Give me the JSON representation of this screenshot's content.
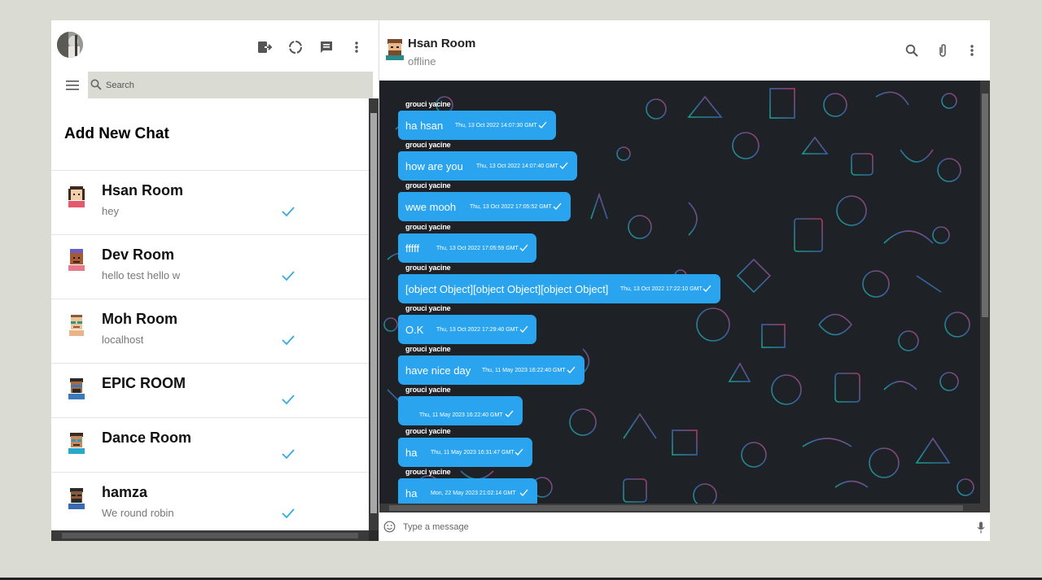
{
  "sidebar": {
    "search_placeholder": "Search",
    "add_chat_label": "Add New Chat",
    "chats": [
      {
        "name": "Hsan Room",
        "last_message": "hey",
        "avatar": "avatar-1"
      },
      {
        "name": "Dev Room",
        "last_message": "hello test hello w",
        "avatar": "avatar-2"
      },
      {
        "name": "Moh Room",
        "last_message": "localhost",
        "avatar": "avatar-3"
      },
      {
        "name": "EPIC ROOM",
        "last_message": "",
        "avatar": "avatar-4"
      },
      {
        "name": "Dance Room",
        "last_message": "",
        "avatar": "avatar-5"
      },
      {
        "name": "hamza",
        "last_message": "We round robin",
        "avatar": "avatar-6"
      }
    ],
    "header_icons": [
      "logout-icon",
      "status-icon",
      "new-chat-icon",
      "more-vert-icon"
    ]
  },
  "chat": {
    "room_name": "Hsan Room",
    "status": "offline",
    "header_icons": [
      "search-icon",
      "attach-icon",
      "more-vert-icon"
    ],
    "composer_placeholder": "Type a message",
    "messages": [
      {
        "sender": "grouci yacine",
        "text": "ha hsan",
        "time": "Thu, 13 Oct 2022 14:07:30 GMT"
      },
      {
        "sender": "grouci yacine",
        "text": "how are you",
        "time": "Thu, 13 Oct 2022 14:07:40 GMT"
      },
      {
        "sender": "grouci yacine",
        "text": "wwe mooh",
        "time": "Thu, 13 Oct 2022 17:05:52 GMT"
      },
      {
        "sender": "grouci yacine",
        "text": "fffff",
        "time": "Thu, 13 Oct 2022 17:05:59 GMT"
      },
      {
        "sender": "grouci yacine",
        "text": "[object Object][object Object][object Object]",
        "time": "Thu, 13 Oct 2022 17:22:10 GMT"
      },
      {
        "sender": "grouci yacine",
        "text": "O.K",
        "time": "Thu, 13 Oct 2022 17:29:40 GMT"
      },
      {
        "sender": "grouci yacine",
        "text": "have nice day",
        "time": "Thu, 11 May 2023 16:22:40 GMT"
      },
      {
        "sender": "grouci yacine",
        "text": "",
        "time": "Thu, 11 May 2023 16:22:40 GMT"
      },
      {
        "sender": "grouci yacine",
        "text": "ha",
        "time": "Thu, 11 May 2023 16:31:47 GMT"
      },
      {
        "sender": "grouci yacine",
        "text": "ha",
        "time": "Mon, 22 May 2023 21:02:14 GMT"
      }
    ]
  },
  "colors": {
    "bubble": "#2aa4ee",
    "tick": "#34a9e6",
    "background": "#dadbd3",
    "chat_bg": "#1e2126"
  }
}
